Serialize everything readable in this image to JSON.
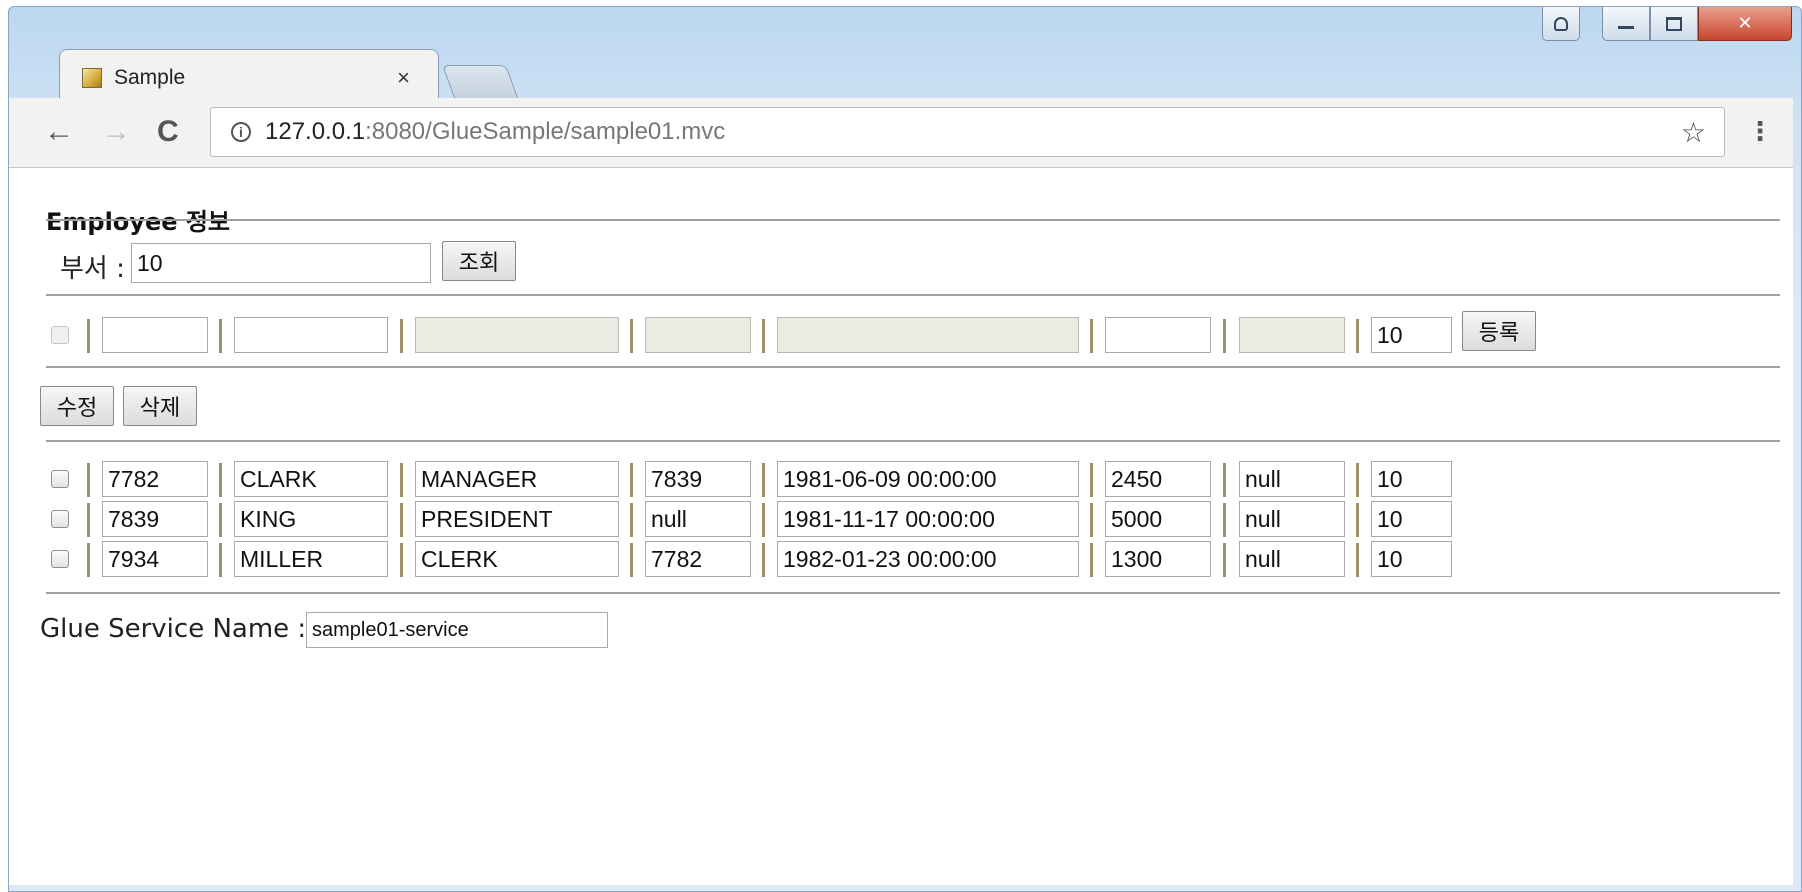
{
  "browser": {
    "tab_title": "Sample",
    "tab_close": "×",
    "url_host": "127.0.0.1",
    "url_rest": ":8080/GlueSample/sample01.mvc",
    "icons": [
      "back-icon",
      "forward-icon",
      "reload-icon",
      "info-icon",
      "star-icon",
      "menu-icon",
      "close-icon",
      "minimize-icon",
      "maximize-icon",
      "user-icon"
    ]
  },
  "page": {
    "title": "Employee 정보",
    "search": {
      "label": "부서 :",
      "value": "10",
      "button": "조회"
    },
    "entry": {
      "fields": [
        "",
        "",
        "",
        "",
        "",
        "",
        "",
        "10"
      ],
      "disabled": [
        false,
        false,
        true,
        true,
        true,
        false,
        true,
        false
      ],
      "button": "등록"
    },
    "actions": {
      "update": "수정",
      "delete": "삭제"
    },
    "rows": [
      [
        "7782",
        "CLARK",
        "MANAGER",
        "7839",
        "1981-06-09 00:00:00",
        "2450",
        "null",
        "10"
      ],
      [
        "7839",
        "KING",
        "PRESIDENT",
        "null",
        "1981-11-17 00:00:00",
        "5000",
        "null",
        "10"
      ],
      [
        "7934",
        "MILLER",
        "CLERK",
        "7782",
        "1982-01-23 00:00:00",
        "1300",
        "null",
        "10"
      ]
    ],
    "service": {
      "label": "Glue Service Name :",
      "value": "sample01-service"
    }
  },
  "colors": {
    "separator": "#a0a0a0",
    "disabled_field": "#ebebe4",
    "close_button": "#c9452c"
  }
}
